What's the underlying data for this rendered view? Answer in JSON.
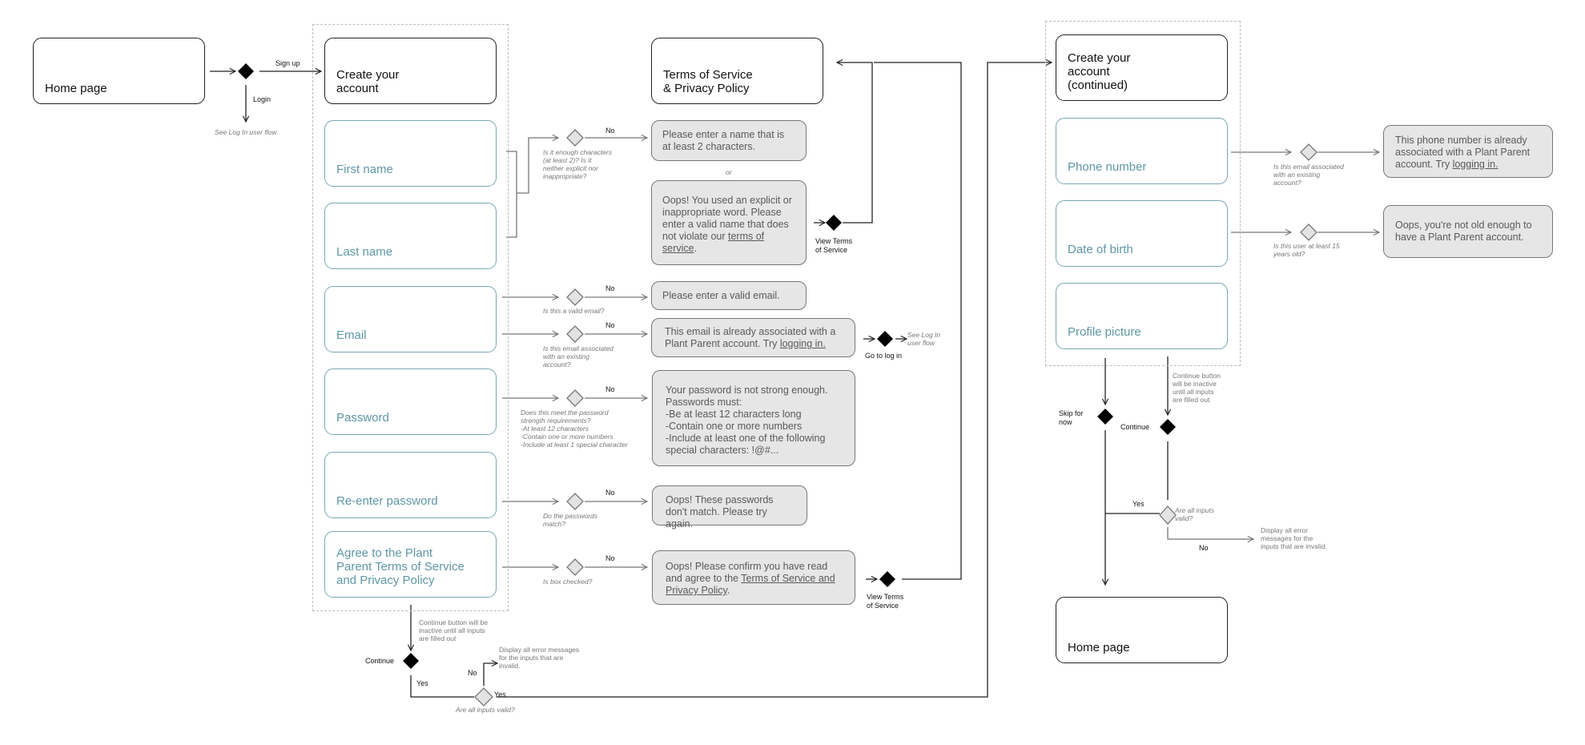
{
  "flow": {
    "home_start": {
      "title": "Home page"
    },
    "entry_choice": {
      "signup_label": "Sign up",
      "login_label": "Login",
      "login_note": "See Log In user flow"
    },
    "create_account": {
      "title": "Create your\naccount",
      "fields": [
        {
          "label": "First name"
        },
        {
          "label": "Last name"
        },
        {
          "label": "Email"
        },
        {
          "label": "Password"
        },
        {
          "label": "Re-enter password"
        },
        {
          "label": "Agree to the Plant\nParent Terms of Service\nand Privacy Policy"
        }
      ],
      "continue_note": "Continue button will be\ninactive until all inputs\nare filled out",
      "continue_label": "Continue",
      "yes_label": "Yes",
      "no_label": "No",
      "valid_question": "Are all inputs valid?",
      "invalid_note": "Display all error messages\nfor the inputs that are\ninvalid.",
      "valid_yes_label": "Yes"
    },
    "terms": {
      "title": "Terms of Service\n& Privacy Policy"
    },
    "checks": [
      {
        "question": "Is it enough characters\n(at least 2)? Is it\nneither explicit nor\ninappropriate?",
        "branch": "No"
      },
      {
        "question": "Is this a valid email?",
        "branch": "No"
      },
      {
        "question": "Is this email associated\nwith an existing\naccount?",
        "branch": "No"
      },
      {
        "question": "Does this meet the password\nstrength requirements?\n-At least 12 characters\n-Contain one or more numbers\n-Include at least 1 special character",
        "branch": "No"
      },
      {
        "question": "Do the passwords\nmatch?",
        "branch": "No"
      },
      {
        "question": "Is box checked?",
        "branch": "No"
      }
    ],
    "errors": {
      "name_short": "Please enter a name that is at least 2 characters.",
      "or_label": "or",
      "name_explicit_pre": "Oops! You used an explicit or inappropriate word. Please enter a valid name that does not violate our ",
      "name_explicit_link": "terms of service",
      "name_explicit_post": ".",
      "email_invalid": "Please enter a valid email.",
      "email_taken_pre": "This email is already associated with a Plant Parent account. Try ",
      "email_taken_link": "logging in.",
      "password_weak": "Your password is not strong enough.\nPasswords must:\n-Be at least 12 characters long\n-Contain one or more numbers\n-Include at least one of the following\nspecial characters: !@#...",
      "password_mismatch": "Oops! These passwords don't match. Please try again.",
      "terms_pre": "Oops! Please confirm you have read and agree to the ",
      "terms_link": "Terms of Service and Privacy Policy",
      "terms_post": "."
    },
    "actions": {
      "view_terms_1": "View Terms\nof Service",
      "view_terms_2": "View Terms\nof Service",
      "go_to_login": "Go to log in",
      "see_login_flow": "See Log In\nuser flow"
    },
    "create_continued": {
      "title": "Create your\naccount\n(continued)",
      "fields": [
        {
          "label": "Phone number"
        },
        {
          "label": "Date of birth"
        },
        {
          "label": "Profile picture"
        }
      ],
      "checks": [
        {
          "question": "Is this email associated\nwith an existing\naccount?"
        },
        {
          "question": "Is this user at least 15\nyears old?"
        }
      ],
      "errors": {
        "phone_taken_pre": "This phone number is already associated with a Plant Parent account. Try ",
        "phone_taken_link": "logging in.",
        "too_young": "Oops, you're not old enough to have a Plant Parent account."
      },
      "skip_label": "Skip for\nnow",
      "continue_label": "Continue",
      "continue_note": "Continue button\nwill be inactive\nuntil all inputs\nare filled out",
      "valid_question": "Are all inputs\nvalid?",
      "yes_label": "Yes",
      "no_label": "No",
      "invalid_note": "Display all error\nmessages for the\ninputs that are invalid."
    },
    "home_end": {
      "title": "Home page"
    }
  }
}
